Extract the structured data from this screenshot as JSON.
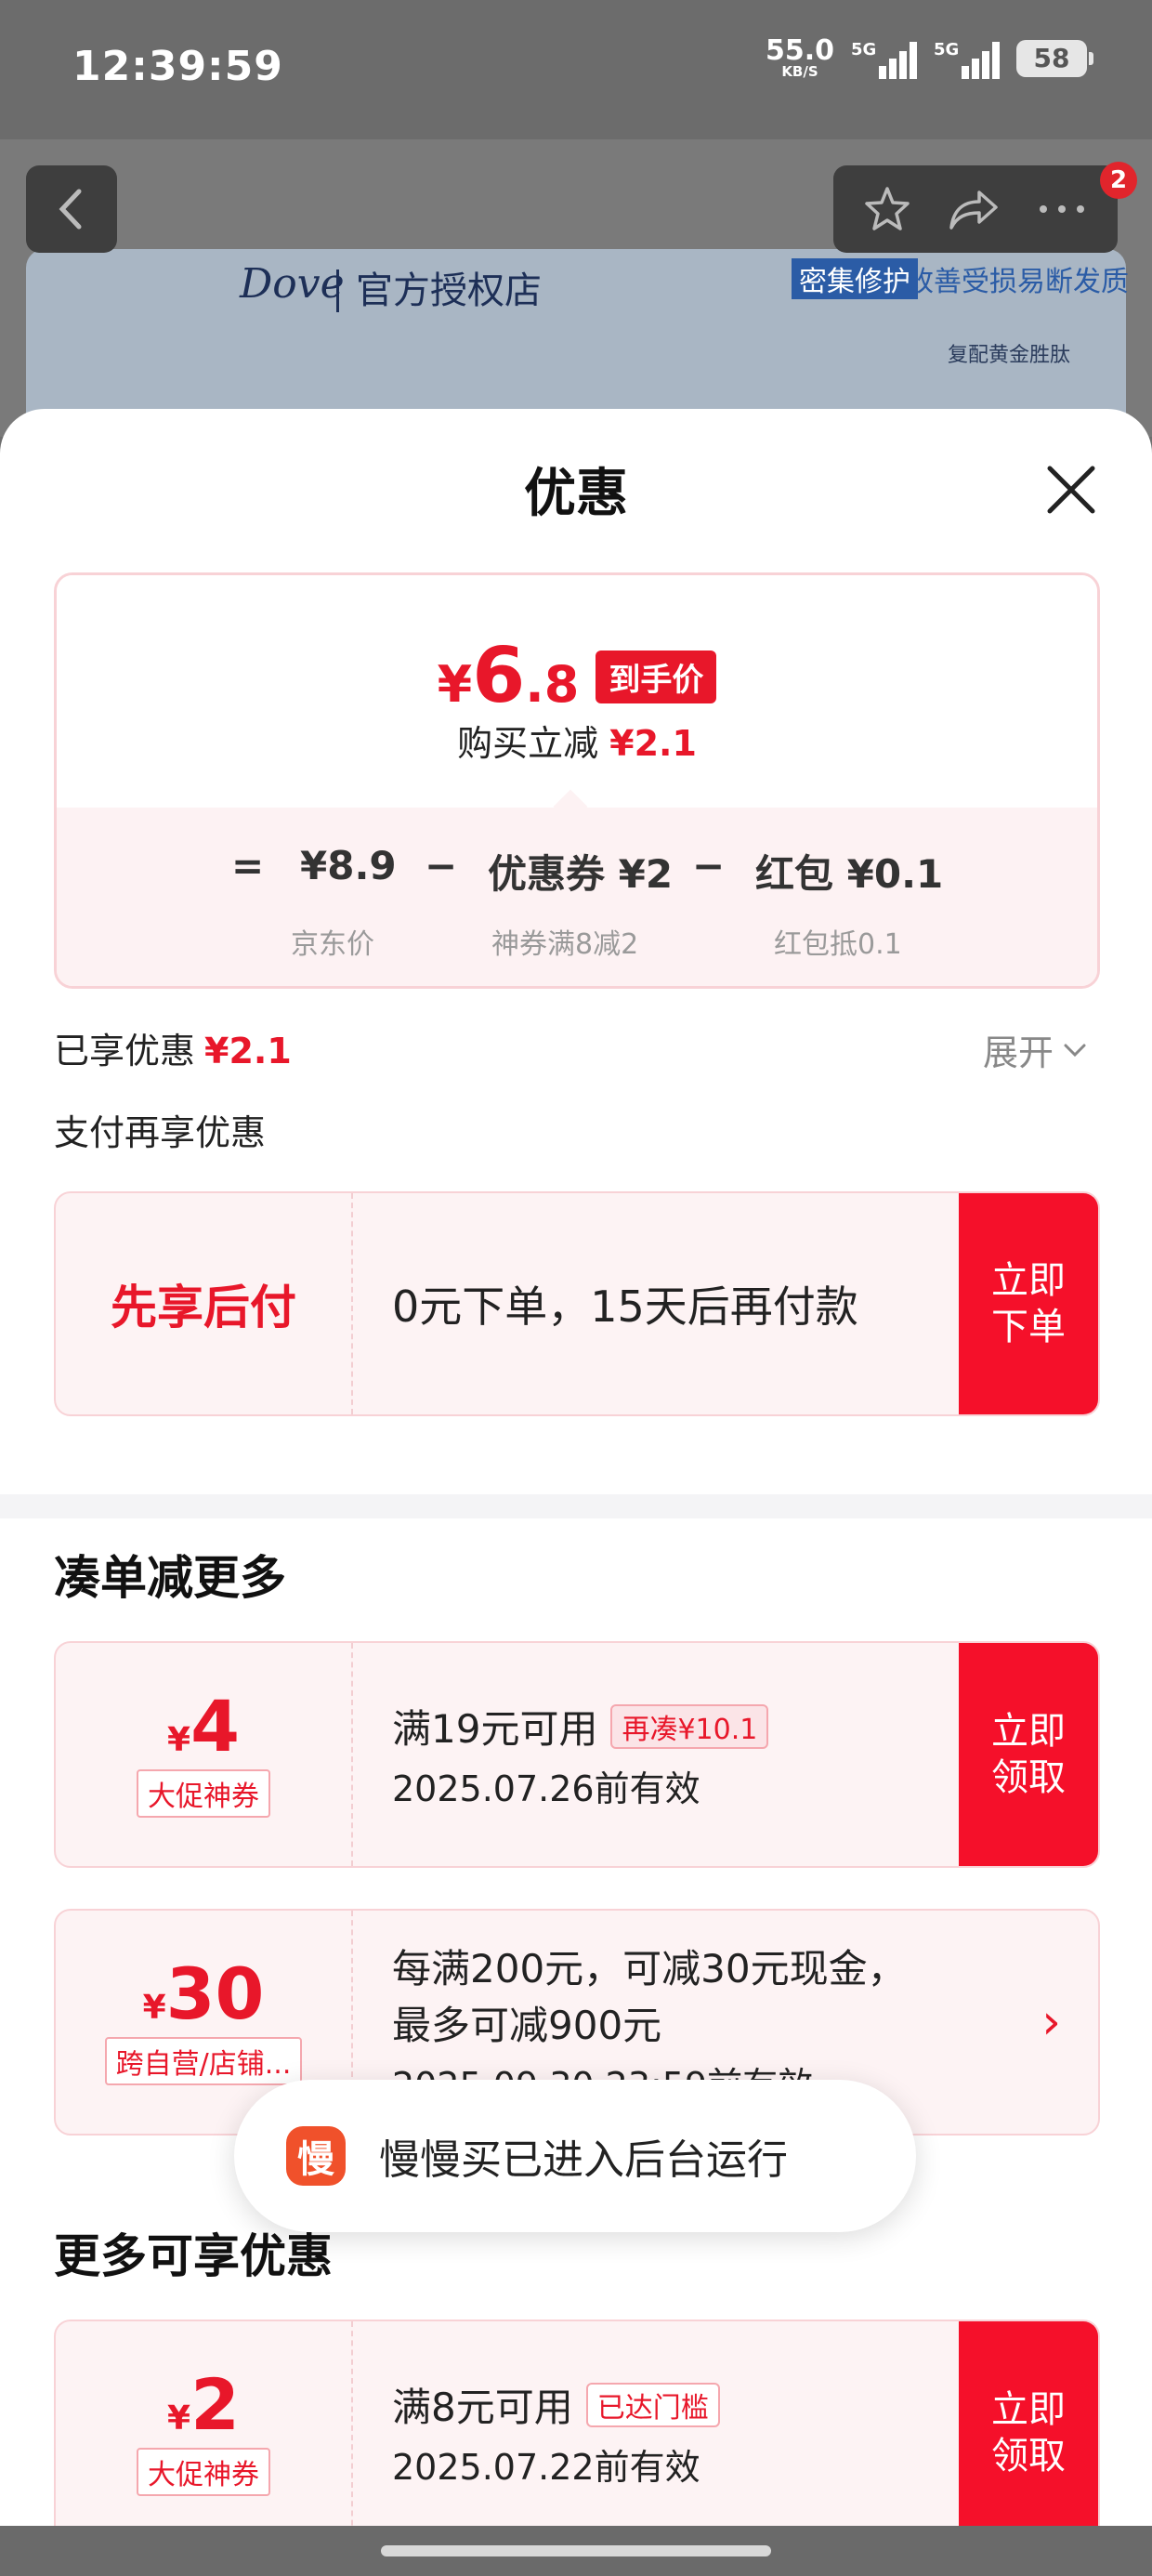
{
  "status_bar": {
    "time": "12:39:59",
    "net_speed": "55.0",
    "net_unit": "KB/S",
    "sig1": "5G",
    "sig2": "5G",
    "battery": "58"
  },
  "background": {
    "brand": "Dove",
    "store": "官方授权店",
    "ad_tag": "密集修护",
    "ad_text": "改善受损易断发质",
    "ad_sub": "复配黄金胜肽",
    "badge": "2"
  },
  "sheet": {
    "title": "优惠",
    "final_price_currency": "¥",
    "final_price_int": "6",
    "final_price_dec": ".8",
    "final_price_tag": "到手价",
    "instant_cut_label": "购买立减",
    "instant_cut_value": "¥2.1",
    "formula": {
      "eq": "=",
      "jd_price": "¥8.9",
      "minus1": "−",
      "coupon": "优惠券 ¥2",
      "minus2": "−",
      "redpacket": "红包 ¥0.1",
      "jd_price_label": "京东价",
      "coupon_label": "神券满8减2",
      "redpacket_label": "红包抵0.1"
    },
    "enjoyed_label": "已享优惠",
    "enjoyed_value": "¥2.1",
    "expand_label": "展开",
    "pay_more_label": "支付再享优惠",
    "pay_later": {
      "title": "先享后付",
      "desc": "0元下单，15天后再付款",
      "action": "立即\n下单"
    },
    "section_more_title": "凑单减更多",
    "coupons_more": [
      {
        "currency": "¥",
        "amount": "4",
        "tag": "大促神券",
        "condition": "满19元可用",
        "cond_tag": "再凑¥10.1",
        "valid": "2025.07.26前有效",
        "action": "立即\n领取"
      },
      {
        "currency": "¥",
        "amount": "30",
        "tag": "跨自营/店铺...",
        "condition": "每满200元，可减30元现金，",
        "condition2": "最多可减900元",
        "valid": "2025.09.30 23:59前有效",
        "action": "›"
      }
    ],
    "section_extra_title": "更多可享优惠",
    "coupons_extra": [
      {
        "currency": "¥",
        "amount": "2",
        "tag": "大促神券",
        "condition": "满8元可用",
        "cond_tag": "已达门槛",
        "valid": "2025.07.22前有效",
        "action": "立即\n领取"
      }
    ]
  },
  "toast": {
    "icon_char": "慢",
    "text": "慢慢买已进入后台运行"
  },
  "colors": {
    "accent": "#e8172a",
    "action_bg": "#f5102a",
    "coupon_bg": "#fdf3f4"
  }
}
